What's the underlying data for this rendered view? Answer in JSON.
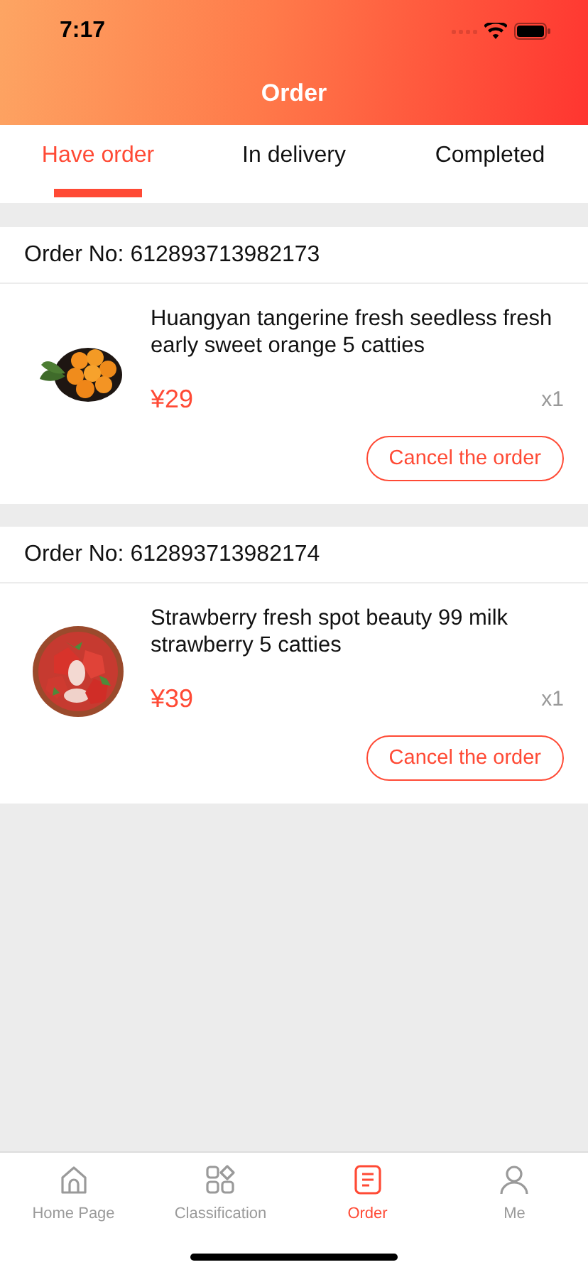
{
  "status_bar": {
    "time": "7:17"
  },
  "header": {
    "title": "Order"
  },
  "tabs": [
    {
      "label": "Have order",
      "selected": true
    },
    {
      "label": "In delivery",
      "selected": false
    },
    {
      "label": "Completed",
      "selected": false
    }
  ],
  "orders": [
    {
      "order_no": "Order No: 612893713982173",
      "product": {
        "kind": "picture",
        "name": "Huangyan tangerine fresh seedless fresh early sweet orange 5 catties",
        "price": "¥29",
        "quantity": "x1"
      },
      "action": "Cancel the order"
    },
    {
      "order_no": "Order No: 612893713982174",
      "product": {
        "kind": "picture",
        "name": "Strawberry fresh spot beauty 99 milk strawberry 5 catties",
        "price": "¥39",
        "quantity": "x1"
      },
      "action": "Cancel the order"
    }
  ],
  "bottom_nav": [
    {
      "label": "Home Page",
      "selected": false
    },
    {
      "label": "Classification",
      "selected": false
    },
    {
      "label": "Order",
      "selected": true
    },
    {
      "label": "Me",
      "selected": false
    }
  ]
}
